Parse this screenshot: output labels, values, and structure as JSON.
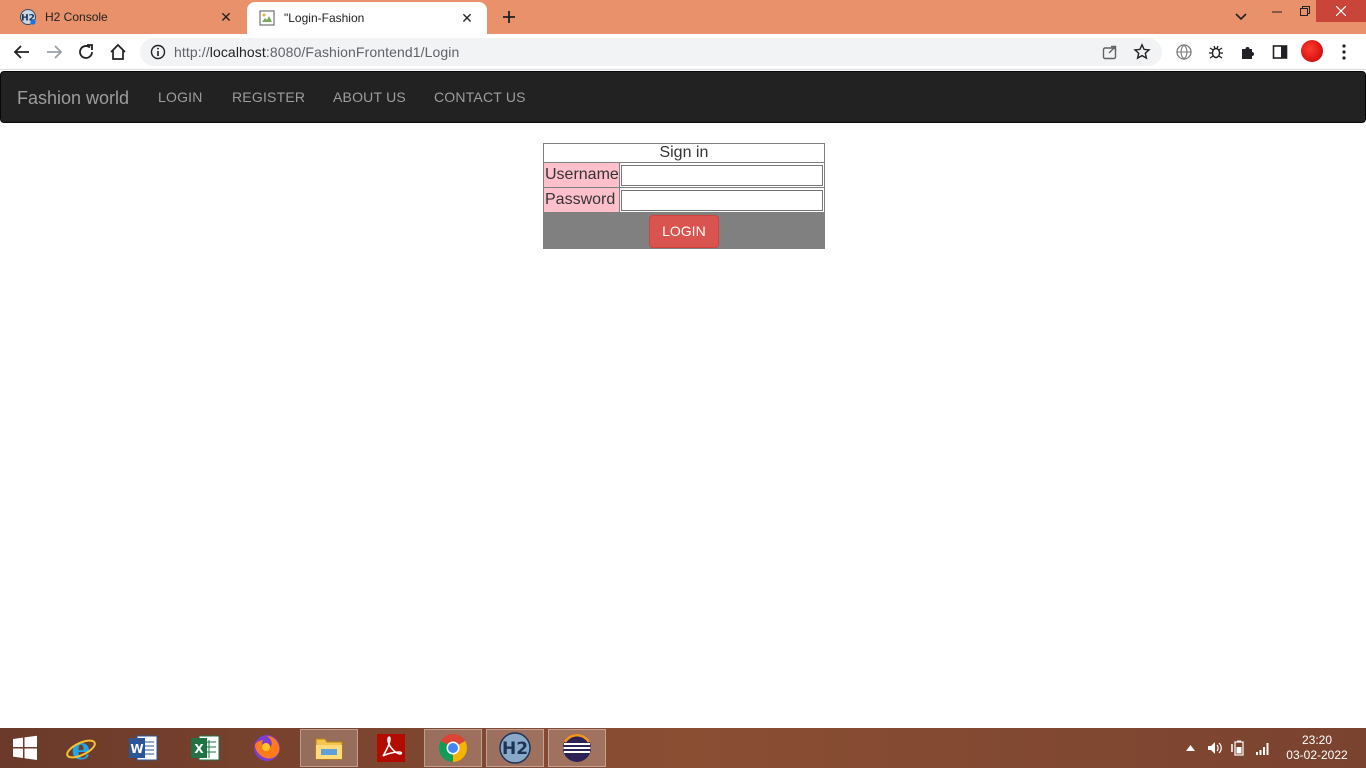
{
  "browser": {
    "tabs": [
      {
        "title": "H2 Console",
        "icon": "h2-favicon"
      },
      {
        "title": "\"Login-Fashion",
        "icon": "broken-image-favicon",
        "active": true
      }
    ],
    "url": {
      "prefix": "http://",
      "host": "localhost",
      "path": ":8080/FashionFrontend1/Login"
    }
  },
  "navbar": {
    "brand": "Fashion world",
    "links": [
      "LOGIN",
      "REGISTER",
      "ABOUT US",
      "CONTACT US"
    ]
  },
  "login_form": {
    "title": "Sign in",
    "username_label": "Username",
    "password_label": "Password",
    "username_value": "",
    "password_value": "",
    "submit_label": "LOGIN"
  },
  "taskbar": {
    "apps": [
      "windows-start",
      "internet-explorer",
      "word",
      "excel",
      "firefox",
      "file-explorer",
      "acrobat",
      "chrome",
      "h2",
      "eclipse"
    ],
    "time": "23:20",
    "date": "03-02-2022"
  },
  "colors": {
    "tabstrip": "#e8916a",
    "navbar": "#222222",
    "label_bg": "#ffc0cb",
    "button_row_bg": "#808080",
    "login_button": "#d9534f"
  }
}
